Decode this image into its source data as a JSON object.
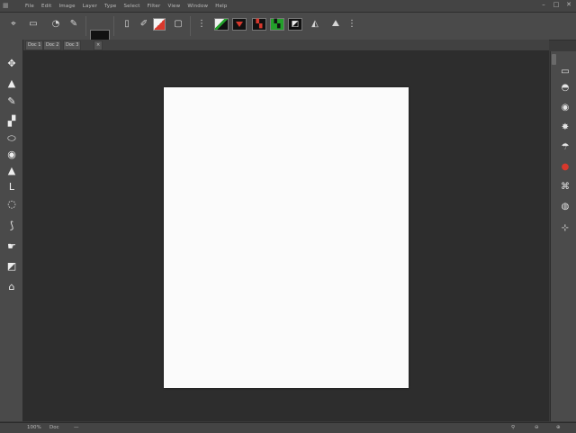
{
  "menu": {
    "items": [
      "File",
      "Edit",
      "Image",
      "Layer",
      "Type",
      "Select",
      "Filter",
      "View",
      "Window",
      "Help"
    ]
  },
  "window_controls": {
    "minimize": "–",
    "maximize": "□",
    "close": "✕"
  },
  "options": {
    "swatch_fg": "#111111",
    "swatch_bg": "#ffffff",
    "accent_red": "#d8382c",
    "accent_green": "#23a02a"
  },
  "tabs": [
    "Doc 1",
    "Doc 2",
    "Doc 3"
  ],
  "left_tools": [
    "move-tool",
    "pen-tool",
    "brush-tool",
    "crop-tool",
    "shape-tool",
    "gradient-tool",
    "triangle-tool",
    "type-tool",
    "lasso-tool",
    "clone-tool",
    "hand-tool",
    "fill-tool",
    "eraser-tool"
  ],
  "right_tools": [
    "layers-icon",
    "history-icon",
    "adjust-icon",
    "brush-preset-icon",
    "color-icon",
    "paths-icon",
    "properties-icon",
    "link-icon"
  ],
  "status": {
    "left": "100%",
    "middle": "Doc",
    "right": "—"
  }
}
